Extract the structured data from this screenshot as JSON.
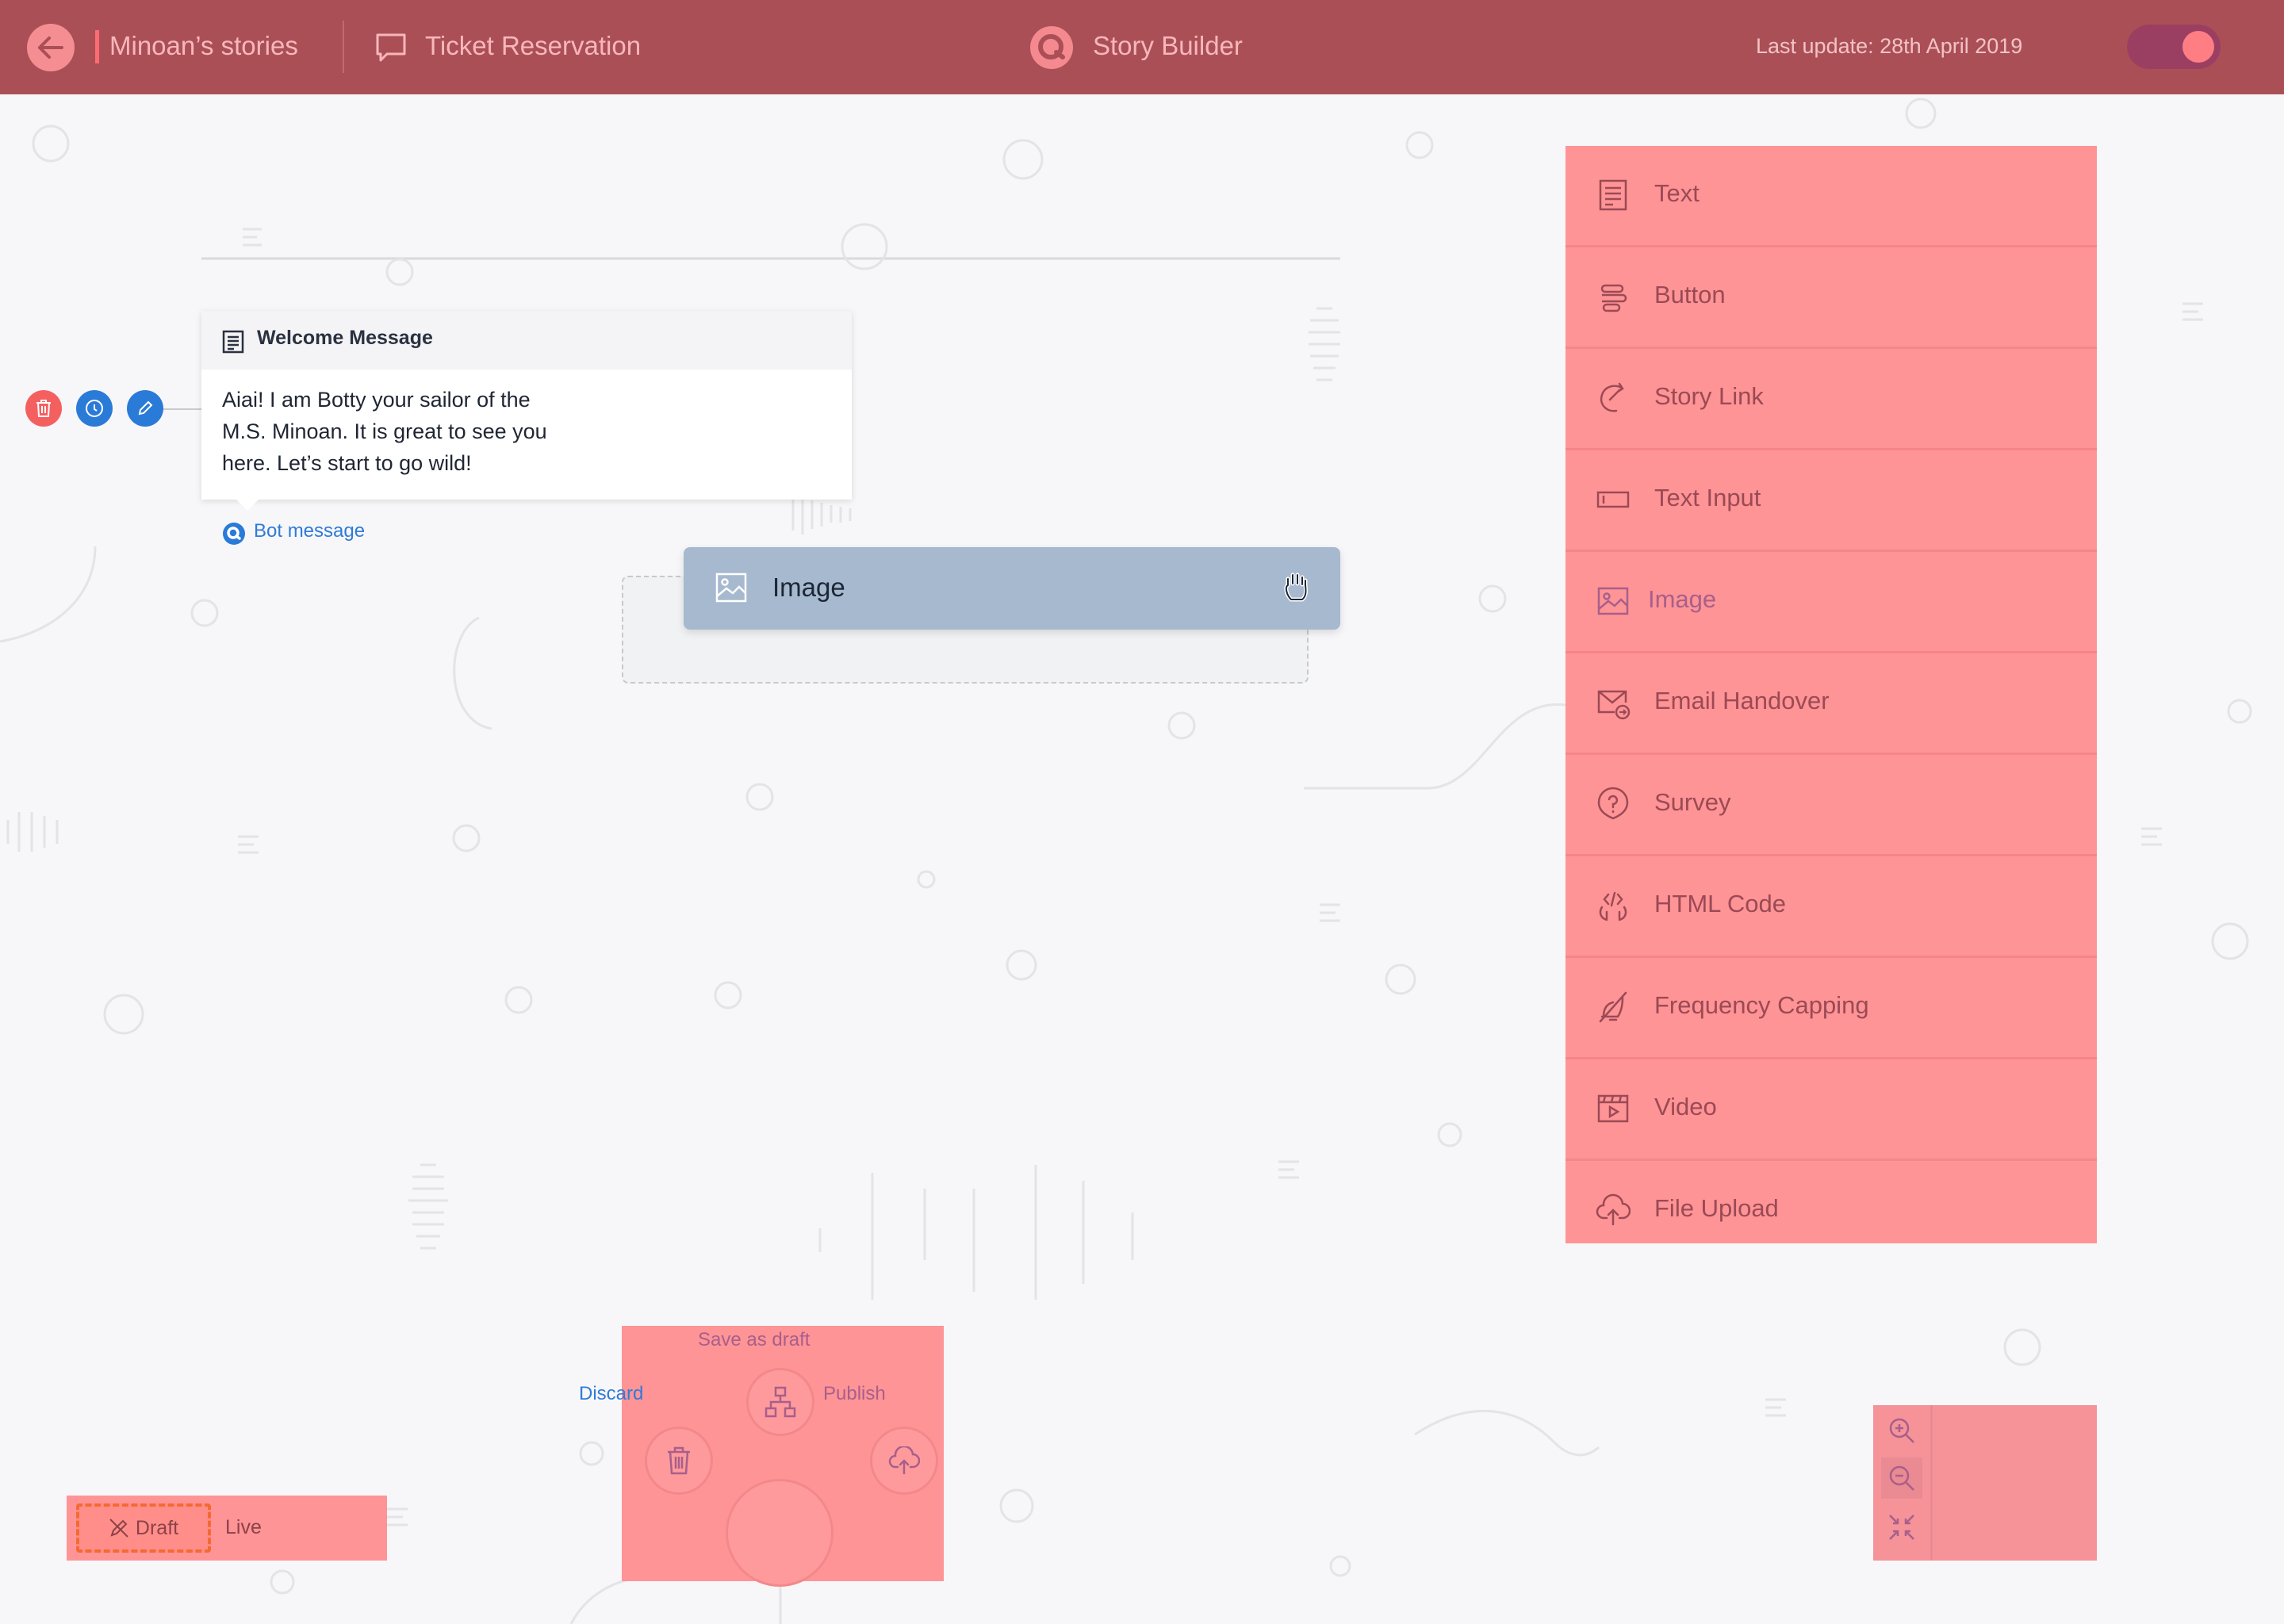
{
  "header": {
    "project": "Minoan’s stories",
    "story": "Ticket Reservation",
    "app_title": "Story Builder",
    "last_update": "Last update: 28th April 2019",
    "toggle_on": true,
    "colors": {
      "header_bg": "#ab4f56",
      "accent": "#ff6b74"
    }
  },
  "welcome_card": {
    "title": "Welcome Message",
    "body_lines": [
      "Aiai! I am Botty your sailor of the",
      "M.S. Minoan. It is great to see you",
      "here. Let’s start to go wild!"
    ],
    "footer_label": "Bot message",
    "actions": [
      "trash-icon",
      "info-icon",
      "pencil-icon"
    ]
  },
  "dragging": {
    "label": "Image",
    "cursor": "grab-hand-icon"
  },
  "palette": {
    "items": [
      {
        "label": "Text",
        "icon": "text-icon"
      },
      {
        "label": "Button",
        "icon": "button-icon"
      },
      {
        "label": "Story Link",
        "icon": "story-link-icon"
      },
      {
        "label": "Text Input",
        "icon": "text-input-icon"
      },
      {
        "label": "Image",
        "icon": "image-icon"
      },
      {
        "label": "Email Handover",
        "icon": "email-handover-icon"
      },
      {
        "label": "Survey",
        "icon": "survey-icon"
      },
      {
        "label": "HTML Code",
        "icon": "html-code-icon"
      },
      {
        "label": "Frequency Capping",
        "icon": "frequency-capping-icon"
      },
      {
        "label": "Video",
        "icon": "video-icon"
      },
      {
        "label": "File Upload",
        "icon": "file-upload-icon"
      }
    ]
  },
  "actions": {
    "save_draft": "Save as draft",
    "discard": "Discard",
    "publish": "Publish"
  },
  "status": {
    "draft": "Draft",
    "live": "Live"
  },
  "zoom": {
    "items": [
      "zoom-in-icon",
      "zoom-out-icon",
      "fit-screen-icon"
    ]
  }
}
